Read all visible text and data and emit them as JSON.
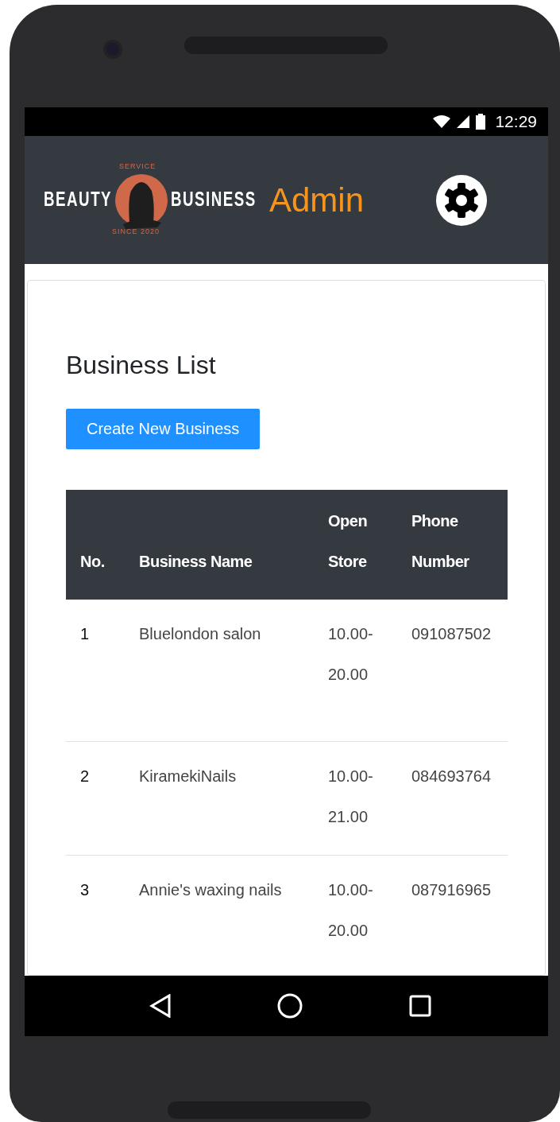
{
  "status_bar": {
    "time": "12:29"
  },
  "header": {
    "logo": {
      "top": "SERVICE",
      "left": "BEAUTY",
      "right": "BUSINESS",
      "bottom": "SINCE 2020"
    },
    "title": "Admin"
  },
  "page": {
    "heading": "Business List",
    "create_button": "Create New Business"
  },
  "table": {
    "columns": [
      "No.",
      "Business Name",
      "Open Store",
      "Phone Number"
    ],
    "rows": [
      {
        "no": "1",
        "name": "Bluelondon salon",
        "open": "10.00-20.00",
        "phone": "091087502"
      },
      {
        "no": "2",
        "name": "KiramekiNails",
        "open": "10.00-21.00",
        "phone": "084693764"
      },
      {
        "no": "3",
        "name": "Annie's waxing nails",
        "open": "10.00-20.00",
        "phone": "087916965"
      }
    ]
  }
}
